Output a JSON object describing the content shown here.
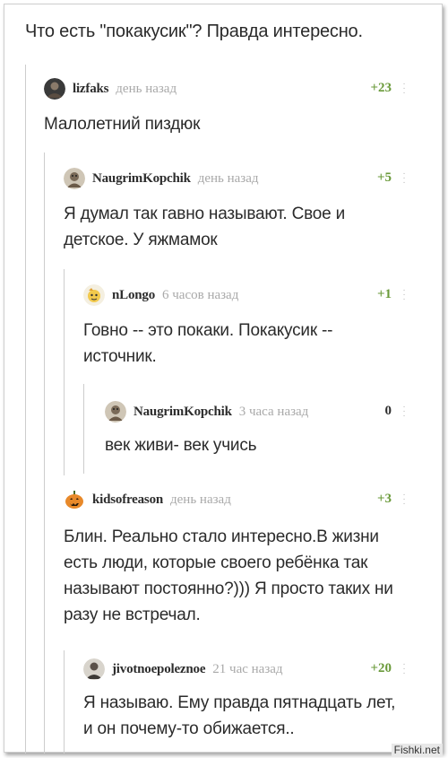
{
  "post": {
    "title": "Что есть \"покакусик\"? Правда интересно."
  },
  "comments": [
    {
      "username": "lizfaks",
      "time": "день назад",
      "rating": "+23",
      "text": "Малолетний пиздюк",
      "avatar_icon": "dark-person-avatar-icon"
    },
    {
      "username": "NaugrimKopchik",
      "time": "день назад",
      "rating": "+5",
      "text": "Я думал так гавно называют. Свое и детское. У яжмамок",
      "avatar_icon": "cartoon-avatar-icon"
    },
    {
      "username": "nLongo",
      "time": "6 часов назад",
      "rating": "+1",
      "text": "Говно -- это покаки. Покакусик -- источник.",
      "avatar_icon": "yellow-character-avatar-icon"
    },
    {
      "username": "NaugrimKopchik",
      "time": "3 часа назад",
      "rating": "0",
      "text": "век живи- век учись",
      "avatar_icon": "cartoon-avatar-icon"
    },
    {
      "username": "kidsofreason",
      "time": "день назад",
      "rating": "+3",
      "text": "Блин. Реально стало интересно.В жизни есть люди, которые своего ребёнка так называют постоянно?))) Я просто таких ни разу не встречал.",
      "avatar_icon": "pumpkin-avatar-icon"
    },
    {
      "username": "jivotnoepoleznoe",
      "time": "21 час назад",
      "rating": "+20",
      "text": "Я называю. Ему правда пятнадцать лет, и он почему-то обижается..",
      "avatar_icon": "person-avatar-icon"
    }
  ],
  "watermark": "Fishki.net",
  "colors": {
    "positive_rating": "#6a9a3a",
    "muted_text": "#a9a9a9",
    "thread_line": "#cdcdcd"
  }
}
